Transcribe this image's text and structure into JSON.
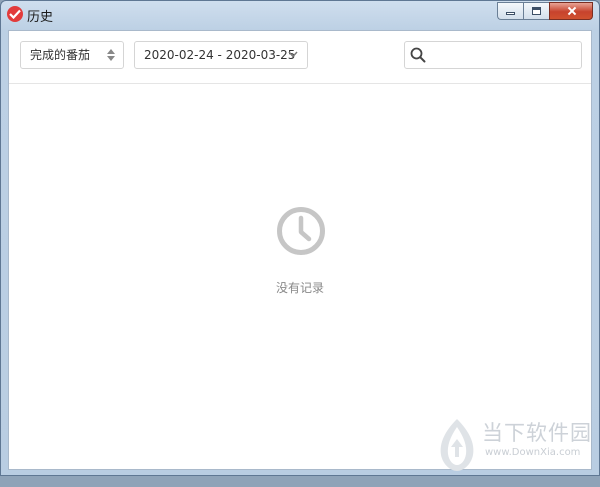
{
  "window": {
    "title": "历史"
  },
  "toolbar": {
    "filter_value": "完成的番茄",
    "date_range": "2020-02-24 - 2020-03-25",
    "search_placeholder": "",
    "search_value": ""
  },
  "empty_state": {
    "message": "没有记录"
  },
  "watermark": {
    "brand": "当下软件园",
    "url": "www.DownXia.com"
  },
  "colors": {
    "accent": "#e23b3b",
    "empty_icon": "#c6c6c6"
  }
}
